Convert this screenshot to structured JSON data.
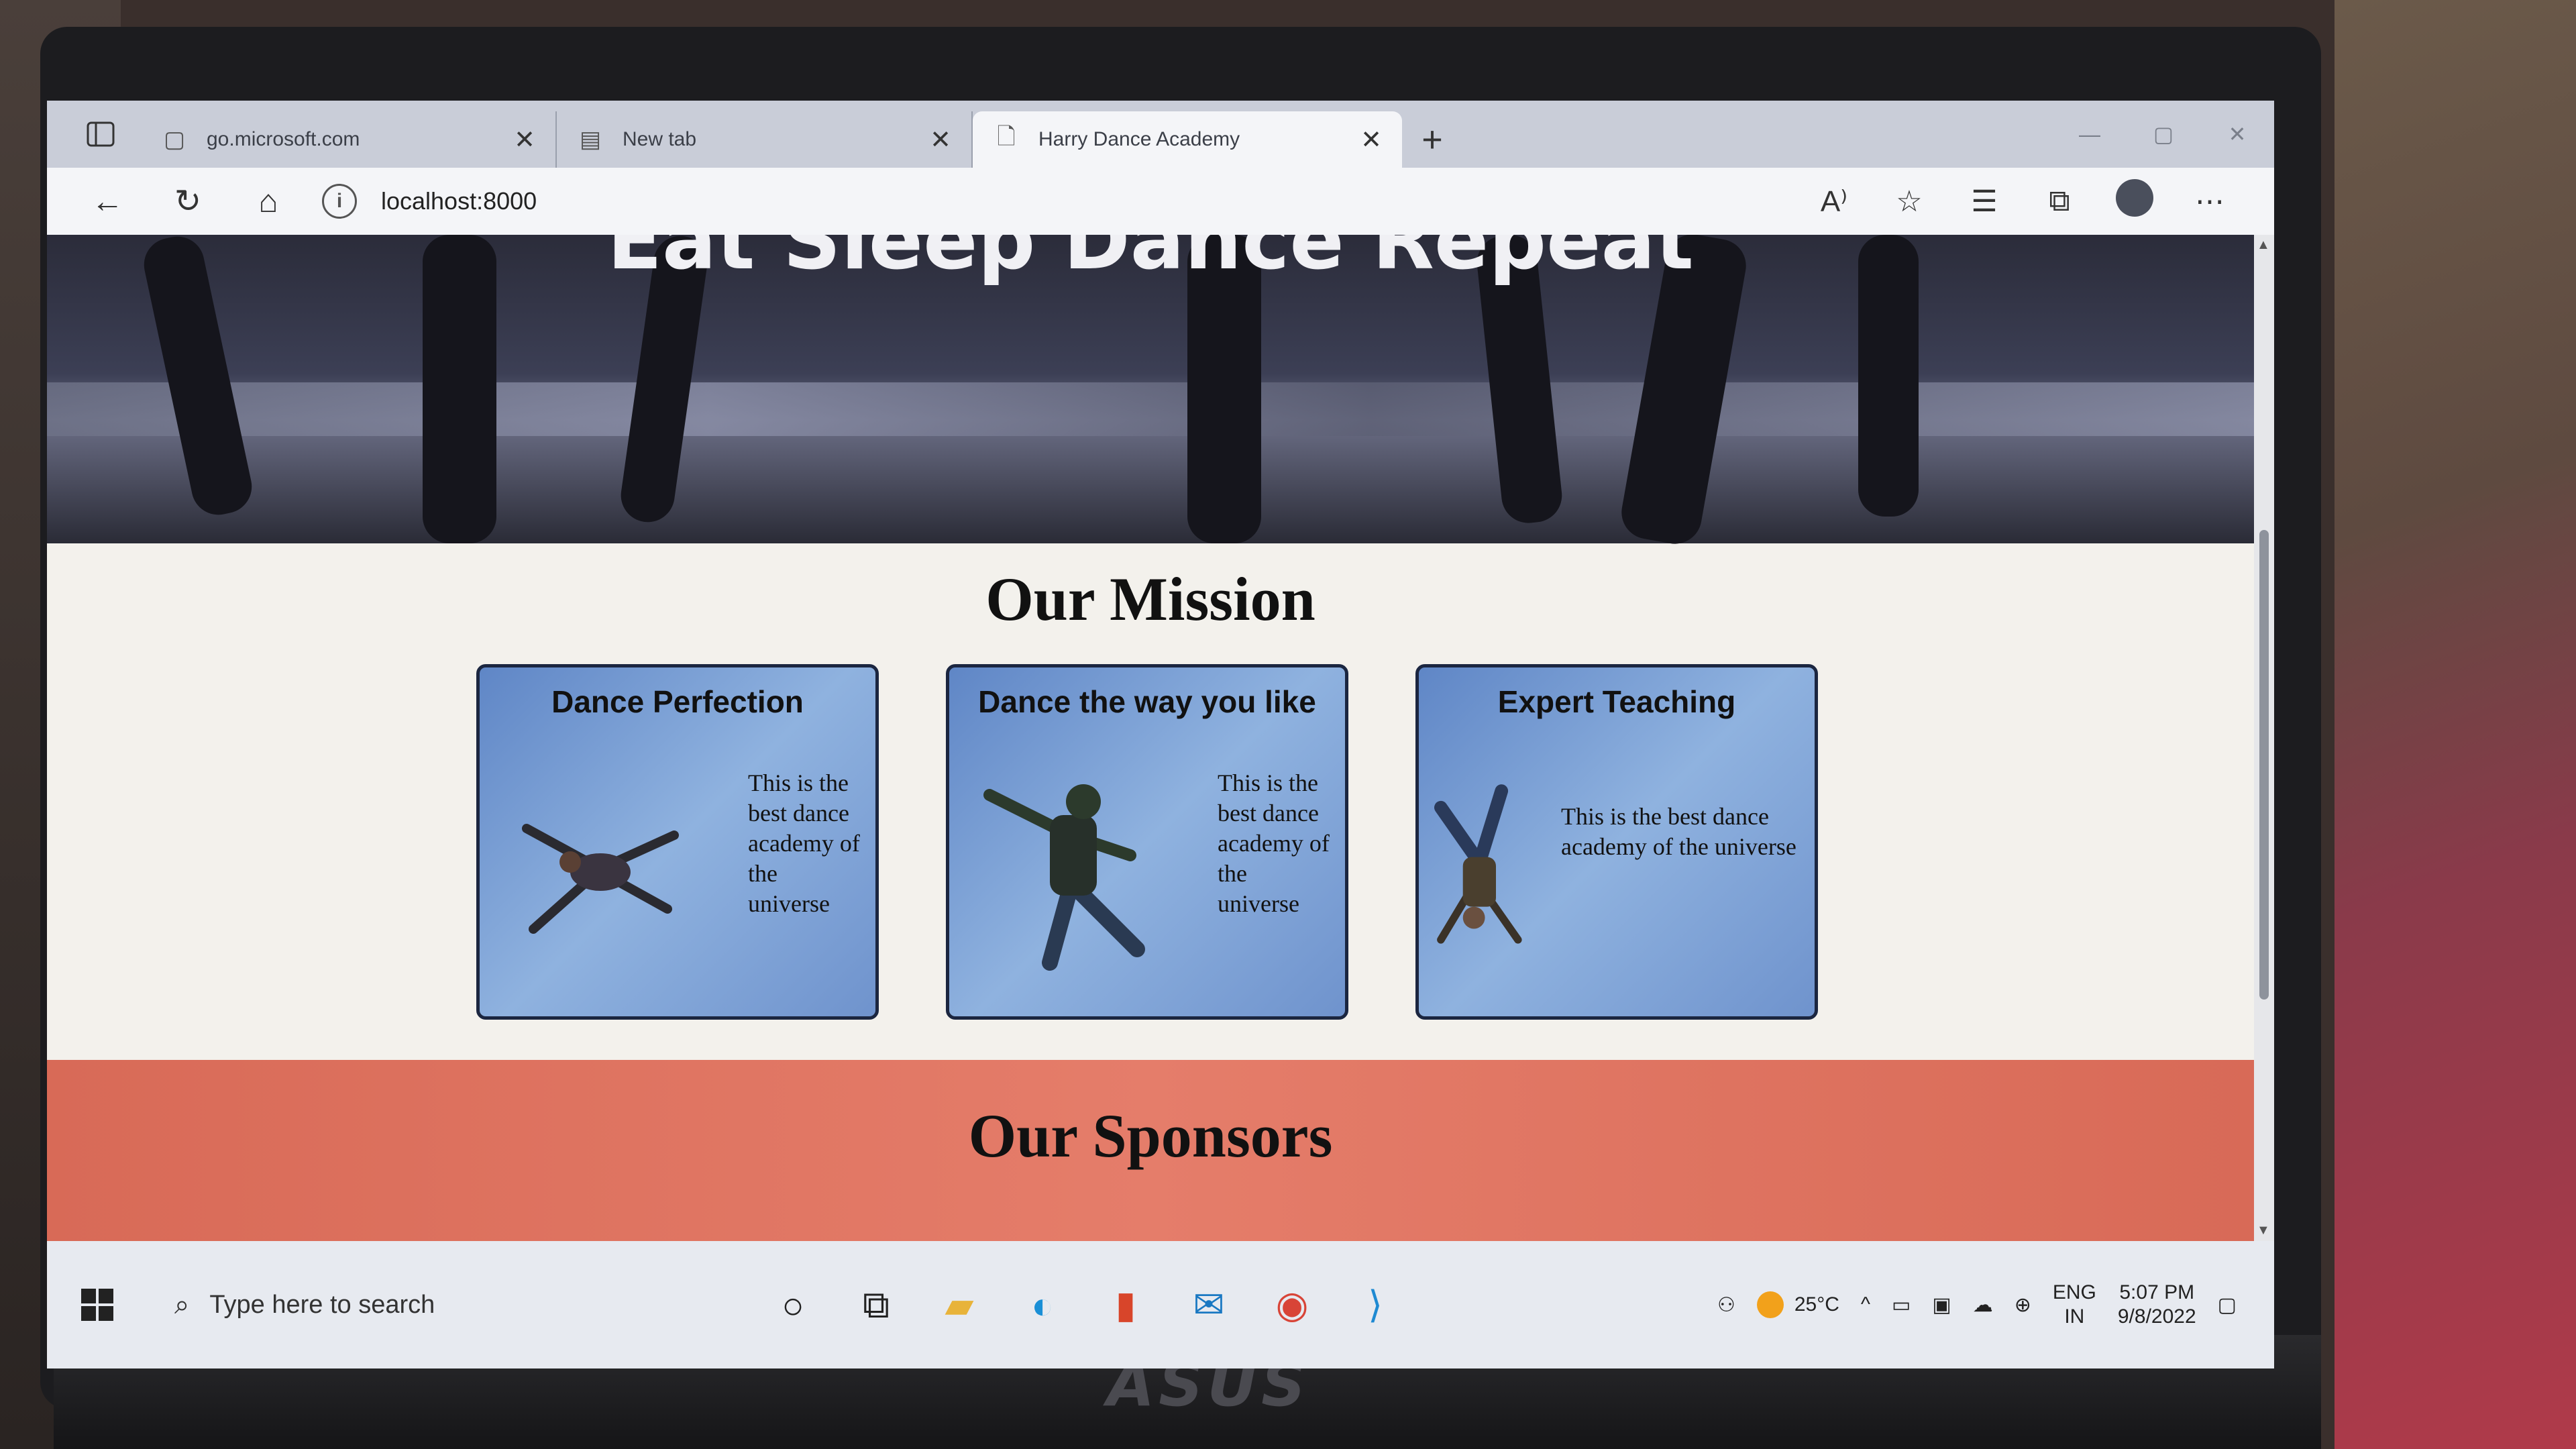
{
  "browser": {
    "tabs": [
      {
        "title": "go.microsoft.com",
        "icon": "page-icon",
        "active": false
      },
      {
        "title": "New tab",
        "icon": "newtab-icon",
        "active": false
      },
      {
        "title": "Harry Dance Academy",
        "icon": "document-icon",
        "active": true
      }
    ],
    "address": "localhost:8000"
  },
  "page": {
    "hero_title": "Eat Sleep Dance Repeat",
    "mission_title": "Our Mission",
    "cards": [
      {
        "title": "Dance Perfection",
        "text": "This is the best dance academy of the universe"
      },
      {
        "title": "Dance the way you like",
        "text": "This is the best dance academy of the universe"
      },
      {
        "title": "Expert Teaching",
        "text": "This is the best dance academy of the universe"
      }
    ],
    "sponsors_title": "Our Sponsors"
  },
  "taskbar": {
    "search_placeholder": "Type here to search",
    "temperature": "25°C",
    "language": "ENG",
    "region": "IN",
    "time": "5:07 PM",
    "date": "9/8/2022"
  },
  "laptop_brand": "ASUS"
}
